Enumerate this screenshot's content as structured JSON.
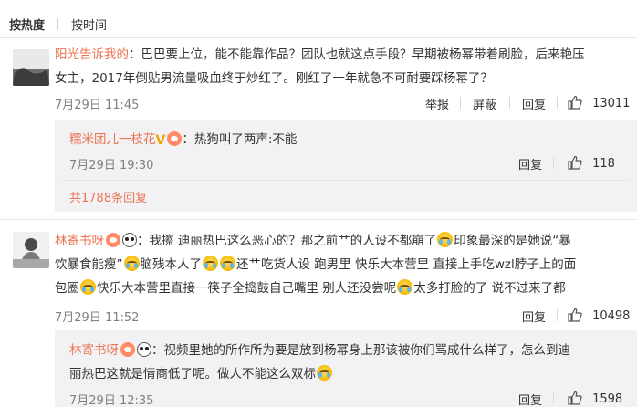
{
  "sort_tabs": {
    "hot": "按热度",
    "time": "按时间"
  },
  "comments": [
    {
      "user": "阳光告诉我的",
      "text_line1": "：巴巴要上位，能不能靠作品？团队也就这点手段？早期被杨幂带着刷脸，后来艳压",
      "text_line2": "女主，2017年倒贴男流量吸血终于炒红了。刚红了一年就急不可耐要踩杨幂了？",
      "time": "7月29日 11:45",
      "actions": {
        "report": "举报",
        "delete": "屏蔽",
        "reply": "回复",
        "likes": "13011"
      },
      "reply": {
        "user": "糯米团儿一枝花",
        "text": "：热狗叫了两声:不能",
        "time": "7月29日 19:30",
        "actions": {
          "reply": "回复",
          "likes": "118"
        }
      },
      "more_replies": "共1788条回复"
    },
    {
      "user": "林寄书呀",
      "text_a": "：我擦  迪丽热巴这么恶心的？那之前艹的人设不都崩了",
      "text_b": "印象最深的是她说“暴",
      "text_c": "饮暴食能瘦”",
      "text_d": "脑残本人了",
      "text_e": "还艹吃货人设 跑男里  快乐大本营里  直接上手吃wzl脖子上的面",
      "text_f": "包圈",
      "text_g": "快乐大本营里直接一筷子全捣鼓自己嘴里 别人还没尝呢",
      "text_h": "太多打脸的了 说不过来了都",
      "time": "7月29日 11:52",
      "actions": {
        "reply": "回复",
        "likes": "10498"
      },
      "reply": {
        "user": "林寄书呀",
        "text_line1": "：视频里她的所作所为要是放到杨幂身上那该被你们骂成什么样了，怎么到迪",
        "text_line2": "丽热巴这就是情商低了呢。做人不能这么双标",
        "time": "7月29日 12:35",
        "actions": {
          "reply": "回复",
          "likes": "1598"
        }
      }
    }
  ],
  "colors": {
    "username": "#eb7350",
    "meta": "#808080",
    "reply_bg": "#f2f2f5"
  }
}
